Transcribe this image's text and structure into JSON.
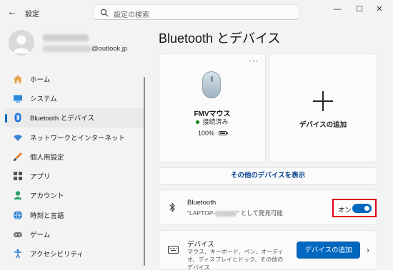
{
  "app": {
    "back_icon": "back-arrow-icon",
    "title": "設定",
    "window_controls": [
      "minimize-icon",
      "maximize-icon",
      "close-icon"
    ]
  },
  "search": {
    "placeholder": "設定の検索",
    "icon": "search-icon"
  },
  "profile": {
    "email_suffix": "@outlook.jp"
  },
  "nav": {
    "items": [
      {
        "label": "ホーム",
        "icon": "home-icon",
        "active": false
      },
      {
        "label": "システム",
        "icon": "system-icon",
        "active": false
      },
      {
        "label": "Bluetooth とデバイス",
        "icon": "bluetooth-icon",
        "active": true
      },
      {
        "label": "ネットワークとインターネット",
        "icon": "wifi-icon",
        "active": false
      },
      {
        "label": "個人用設定",
        "icon": "brush-icon",
        "active": false
      },
      {
        "label": "アプリ",
        "icon": "apps-icon",
        "active": false
      },
      {
        "label": "アカウント",
        "icon": "account-icon",
        "active": false
      },
      {
        "label": "時刻と言語",
        "icon": "globe-icon",
        "active": false
      },
      {
        "label": "ゲーム",
        "icon": "gamepad-icon",
        "active": false
      },
      {
        "label": "アクセシビリティ",
        "icon": "accessibility-icon",
        "active": false
      }
    ]
  },
  "main": {
    "title": "Bluetooth とデバイス",
    "device_card": {
      "name": "FMVマウス",
      "status": "接続済み",
      "battery": "100%",
      "more": "···"
    },
    "add_card": {
      "label": "デバイスの追加"
    },
    "show_more": "その他のデバイスを表示",
    "bluetooth_row": {
      "title": "Bluetooth",
      "subtitle_prefix": "\"LAPTOP-",
      "subtitle_suffix": "\" として発見可能",
      "toggle_label": "オン",
      "toggle_on": true
    },
    "devices_row": {
      "title": "デバイス",
      "subtitle": "マウス、キーボード、ペン、オーディオ、ディスプレイとドック、その他のデバイス",
      "button": "デバイスの追加"
    }
  },
  "colors": {
    "accent": "#0067c0",
    "highlight": "#e0001b",
    "connected": "#0f7b0f"
  }
}
